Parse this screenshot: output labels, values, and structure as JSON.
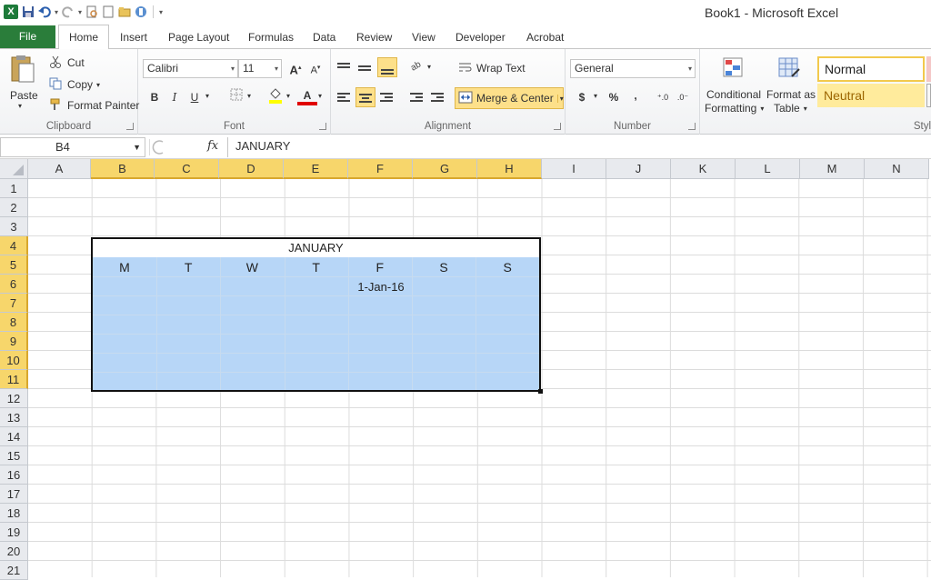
{
  "window": {
    "title": "Book1  -  Microsoft Excel"
  },
  "qat": {
    "logo": "X"
  },
  "tabs": [
    {
      "label": "File"
    },
    {
      "label": "Home"
    },
    {
      "label": "Insert"
    },
    {
      "label": "Page Layout"
    },
    {
      "label": "Formulas"
    },
    {
      "label": "Data"
    },
    {
      "label": "Review"
    },
    {
      "label": "View"
    },
    {
      "label": "Developer"
    },
    {
      "label": "Acrobat"
    }
  ],
  "ribbon": {
    "clipboard": {
      "paste": "Paste",
      "cut": "Cut",
      "copy": "Copy",
      "format_painter": "Format Painter",
      "label": "Clipboard"
    },
    "font": {
      "name": "Calibri",
      "size": "11",
      "bold": "B",
      "italic": "I",
      "underline": "U",
      "grow": "A",
      "shrink": "A",
      "font_color": "A",
      "label": "Font"
    },
    "alignment": {
      "wrap_text": "Wrap Text",
      "merge_center": "Merge & Center",
      "label": "Alignment"
    },
    "number": {
      "format": "General",
      "currency": "$",
      "percent": "%",
      "comma": ",",
      "label": "Number"
    },
    "styles": {
      "conditional": "Conditional",
      "conditional2": "Formatting",
      "format_as": "Format as",
      "format_as2": "Table",
      "normal": "Normal",
      "neutral": "Neutral",
      "label": "Styl"
    }
  },
  "formula_bar": {
    "name_box": "B4",
    "fx": "fx",
    "formula": "JANUARY"
  },
  "grid": {
    "columns": [
      "A",
      "B",
      "C",
      "D",
      "E",
      "F",
      "G",
      "H",
      "I",
      "J",
      "K",
      "L",
      "M",
      "N"
    ],
    "rows": [
      "1",
      "2",
      "3",
      "4",
      "5",
      "6",
      "7",
      "8",
      "9",
      "10",
      "11",
      "12",
      "13",
      "14",
      "15",
      "16",
      "17",
      "18",
      "19",
      "20",
      "21"
    ],
    "selected_columns": [
      "B",
      "C",
      "D",
      "E",
      "F",
      "G",
      "H"
    ],
    "selected_rows": [
      "4",
      "5",
      "6",
      "7",
      "8",
      "9",
      "10",
      "11"
    ]
  },
  "calendar": {
    "title": "JANUARY",
    "days": [
      "M",
      "T",
      "W",
      "T",
      "F",
      "S",
      "S"
    ],
    "first_date": "1-Jan-16",
    "fill_color": "#b7d6f7"
  }
}
